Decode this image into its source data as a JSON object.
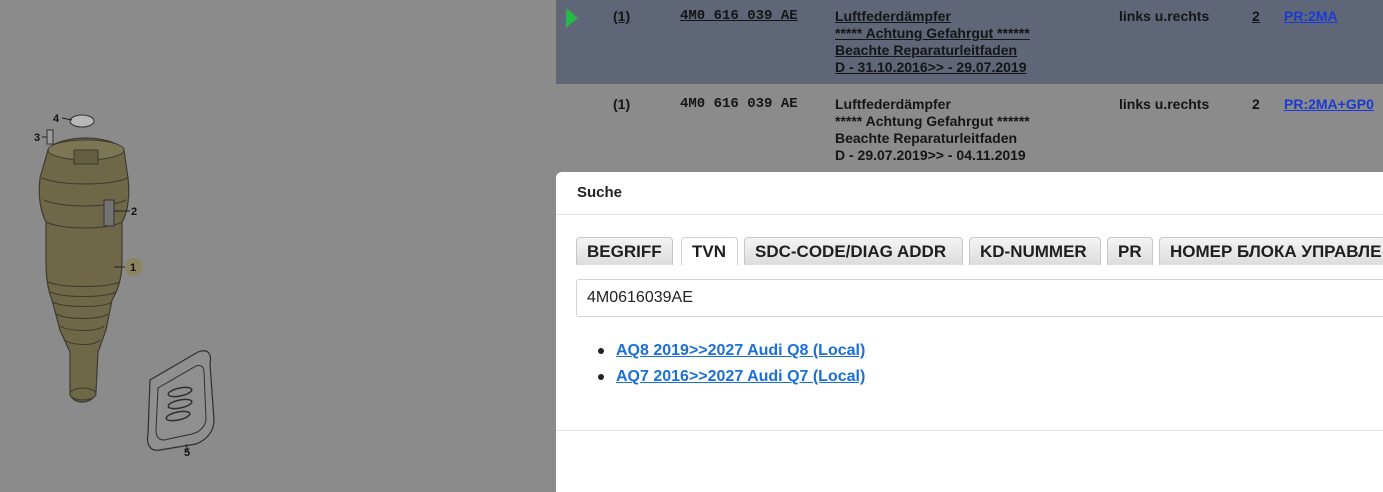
{
  "diagram": {
    "callouts": [
      "1",
      "2",
      "3",
      "4",
      "5"
    ]
  },
  "parts_table": {
    "rows": [
      {
        "selected": true,
        "qty": "(1)",
        "part_no": "4M0 616 039 AE",
        "desc": [
          "Luftfederdämpfer",
          "***** Achtung Gefahrgut ******",
          "Beachte Reparaturleitfaden",
          "D - 31.10.2016>> - 29.07.2019"
        ],
        "side": "links u.rechts",
        "count": "2",
        "pr": "PR:2MA"
      },
      {
        "selected": false,
        "qty": "(1)",
        "part_no": "4M0 616 039 AE",
        "desc": [
          "Luftfederdämpfer",
          "***** Achtung Gefahrgut ******",
          "Beachte Reparaturleitfaden",
          "D - 29.07.2019>> - 04.11.2019"
        ],
        "side": "links u.rechts",
        "count": "2",
        "pr": "PR:2MA+GP0"
      }
    ]
  },
  "dialog": {
    "title": "Suche",
    "tabs": [
      "BEGRIFF",
      "TVN",
      "SDC-CODE/DIAG ADDR",
      "KD-NUMMER",
      "PR",
      "НОМЕР БЛОКА УПРАВЛЕ"
    ],
    "active_tab": "TVN",
    "search_value": "4M0616039AE",
    "results": [
      "AQ8 2019>>2027 Audi Q8 (Local)",
      "AQ7 2016>>2027 Audi Q7 (Local)"
    ]
  },
  "colors": {
    "overlay": "#8b8b8b",
    "selected_row": "#5e6677",
    "link": "#1b6fd8",
    "arrow": "#27b84b"
  }
}
